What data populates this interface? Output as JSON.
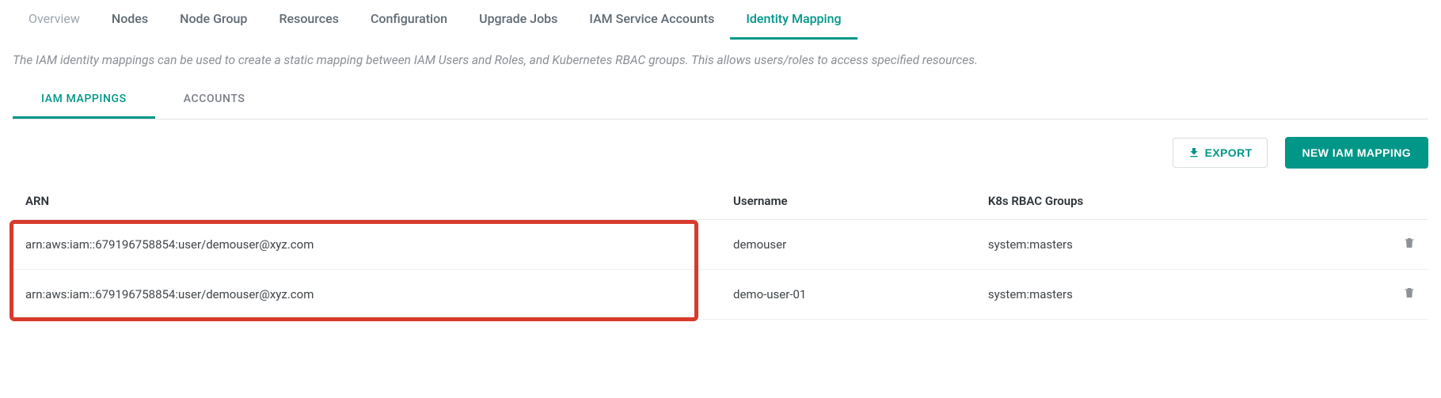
{
  "topTabs": {
    "overview": "Overview",
    "nodes": "Nodes",
    "nodeGroup": "Node Group",
    "resources": "Resources",
    "configuration": "Configuration",
    "upgradeJobs": "Upgrade Jobs",
    "iamServiceAccounts": "IAM Service Accounts",
    "identityMapping": "Identity Mapping"
  },
  "description": "The IAM identity mappings can be used to create a static mapping between IAM Users and Roles, and Kubernetes RBAC groups. This allows users/roles to access specified resources.",
  "subTabs": {
    "iamMappings": "IAM MAPPINGS",
    "accounts": "ACCOUNTS"
  },
  "toolbar": {
    "export": "EXPORT",
    "newMapping": "NEW IAM MAPPING"
  },
  "table": {
    "headers": {
      "arn": "ARN",
      "username": "Username",
      "groups": "K8s RBAC Groups"
    },
    "rows": [
      {
        "arn": "arn:aws:iam::679196758854:user/demouser@xyz.com",
        "username": "demouser",
        "groups": "system:masters"
      },
      {
        "arn": "arn:aws:iam::679196758854:user/demouser@xyz.com",
        "username": "demo-user-01",
        "groups": "system:masters"
      }
    ]
  }
}
